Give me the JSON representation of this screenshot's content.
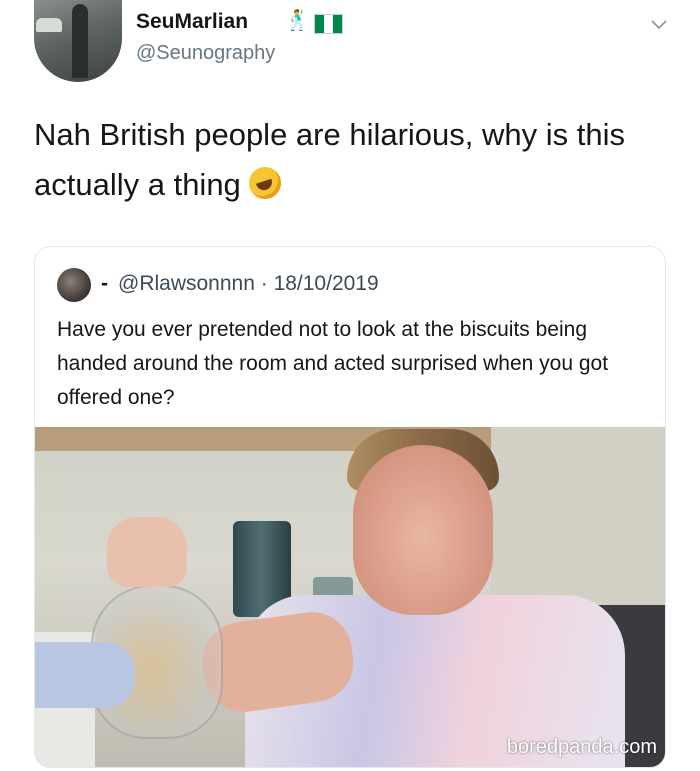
{
  "tweet": {
    "display_name": "SeuMarlian",
    "name_emoji": "🕺",
    "flag_colors": [
      "#008751",
      "#ffffff",
      "#008751"
    ],
    "handle": "@Seunography",
    "text": "Nah British people are hilarious, why is this actually a thing",
    "text_emoji": "rolling-on-floor-laughing-icon",
    "menu_icon": "chevron-down-icon"
  },
  "quoted_tweet": {
    "separator": "-",
    "handle": "@Rlawsonnnn",
    "date_sep": " · ",
    "date": "18/10/2019",
    "text": "Have you ever pretended not to look at the biscuits being handed around the room and acted surprised when you got offered one?"
  },
  "watermark": "boredpanda.com",
  "colors": {
    "text": "#14171a",
    "secondary": "#657786",
    "border": "#e1e8ed"
  }
}
